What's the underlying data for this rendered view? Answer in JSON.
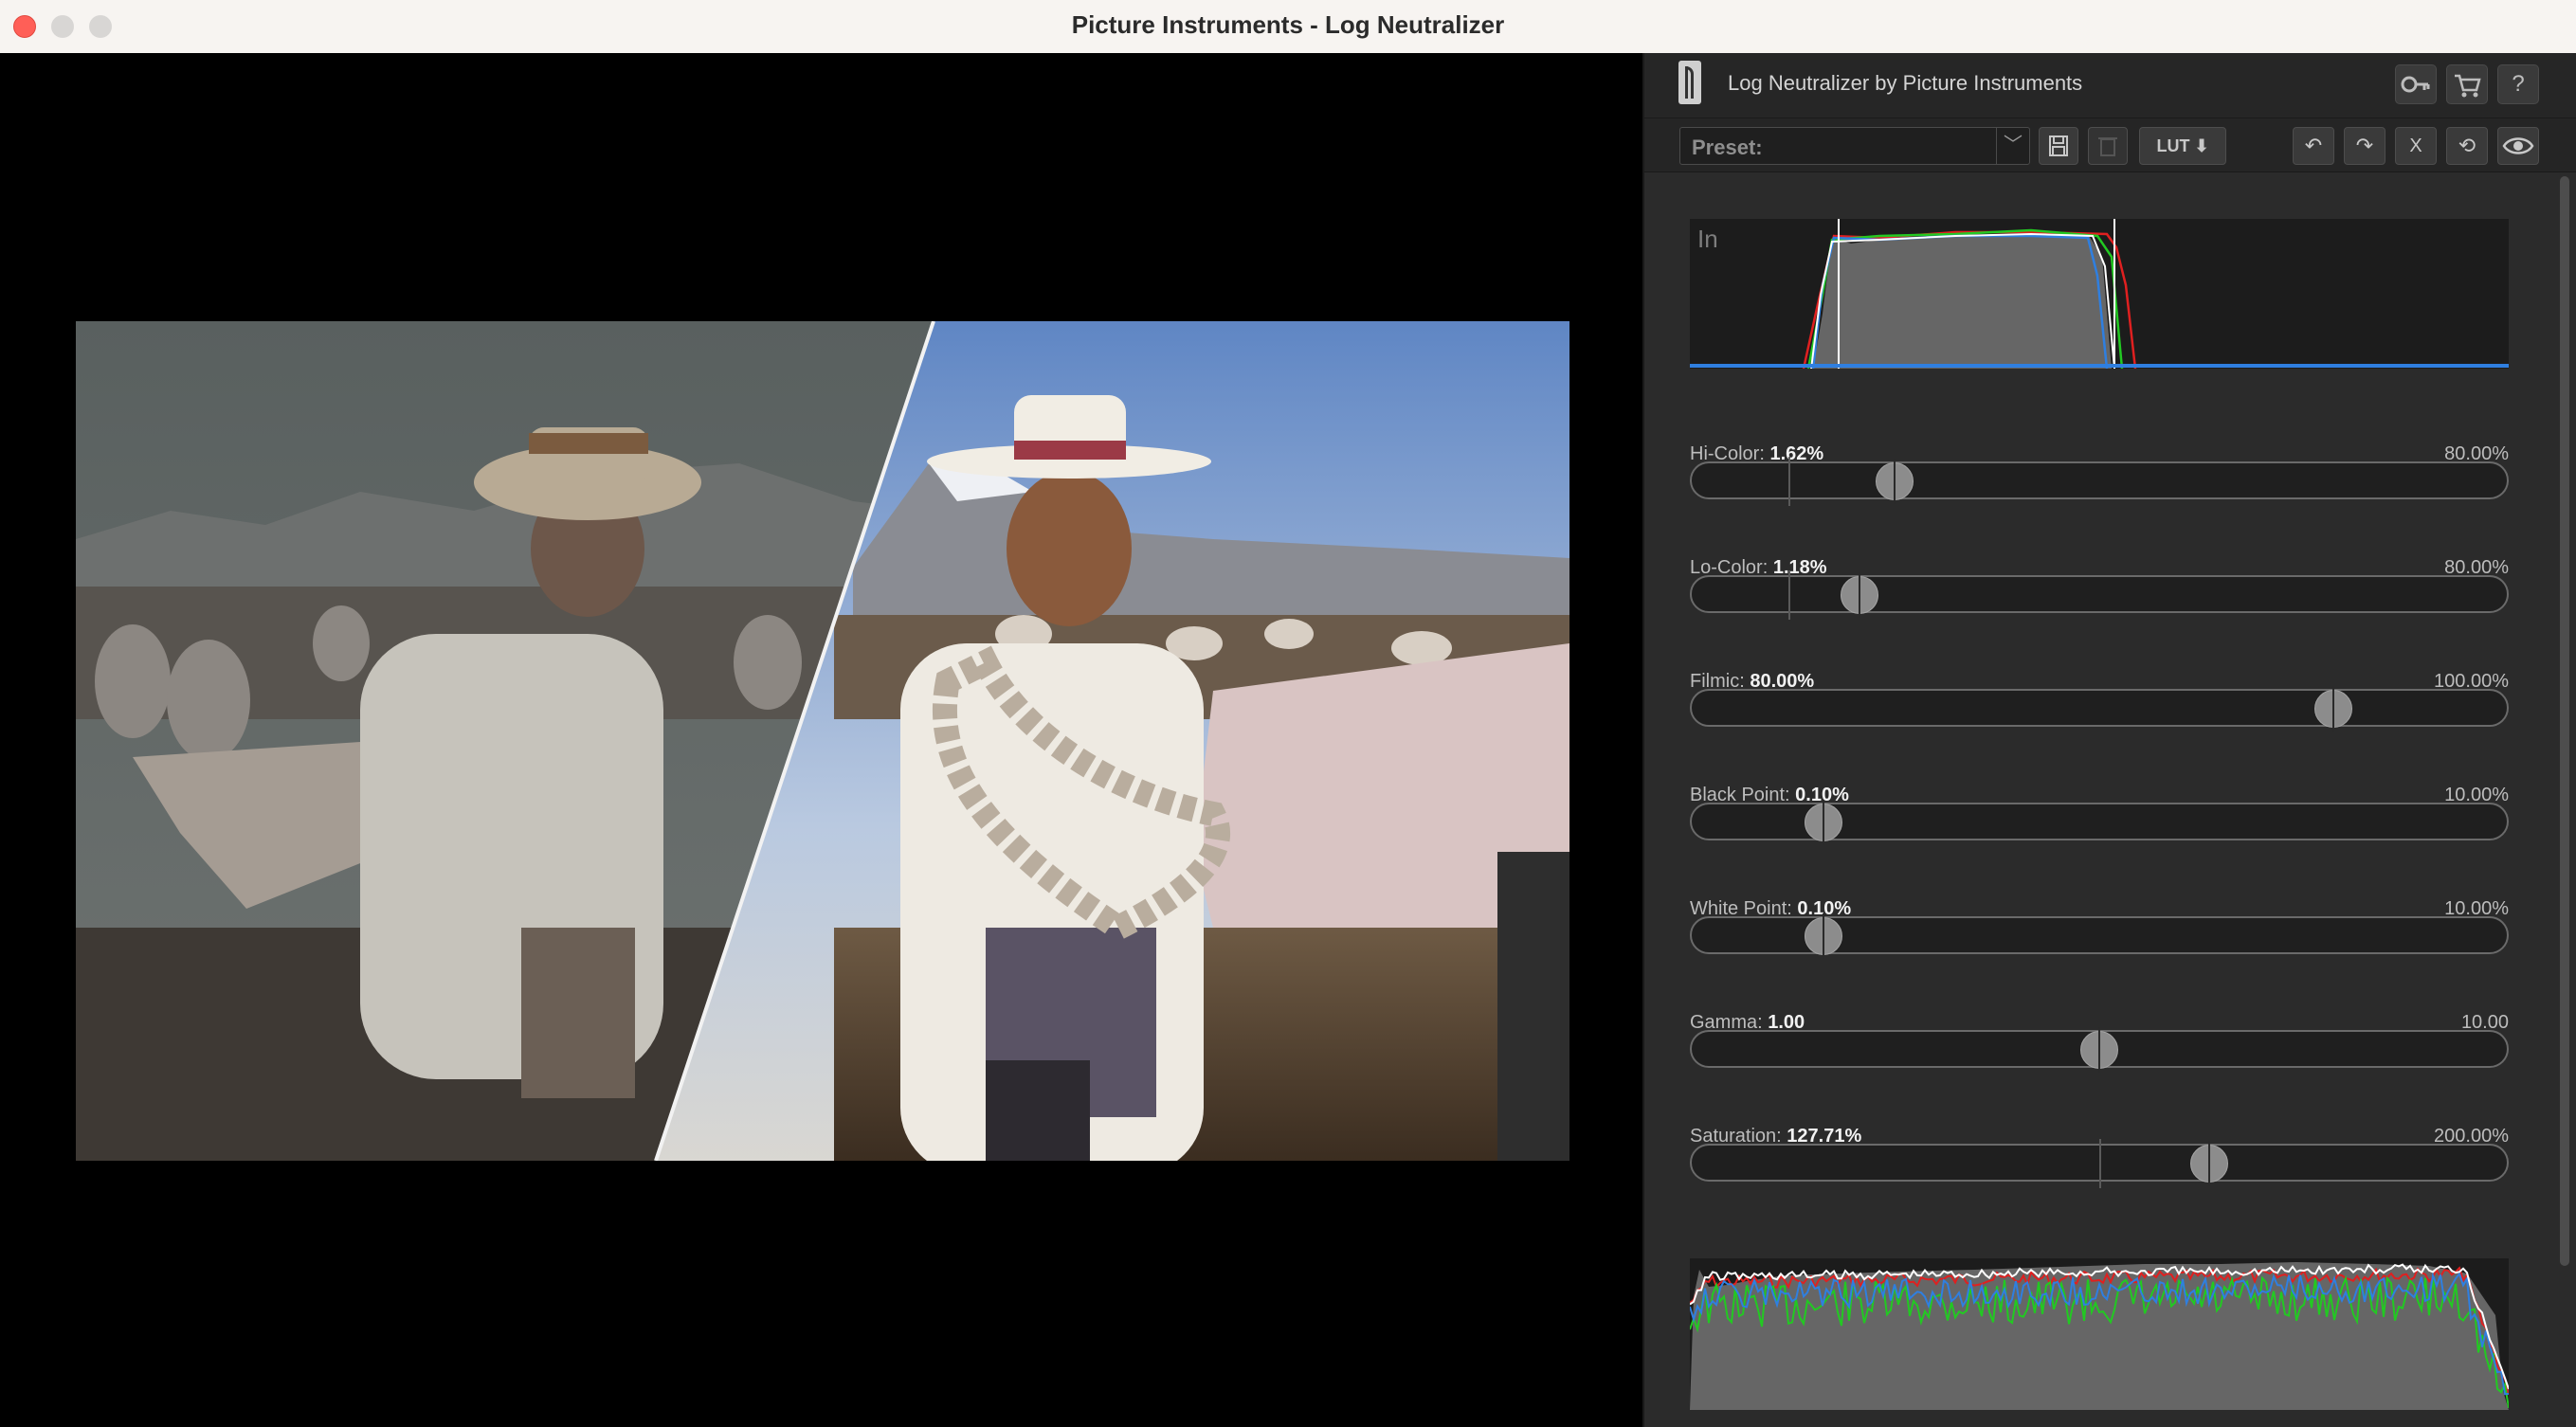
{
  "window": {
    "title": "Picture Instruments - Log Neutralizer"
  },
  "panel": {
    "title": "Log Neutralizer by Picture Instruments",
    "header_icons": [
      "key-icon",
      "cart-icon",
      "help-icon"
    ],
    "help_label": "?",
    "preset": {
      "label": "Preset:",
      "arrow": "﹀"
    },
    "toolbar": {
      "lut_label": "LUT ⬇",
      "undo_glyph": "↶",
      "redo_glyph": "↷",
      "clear_label": "X",
      "reset_glyph": "⟲",
      "eye_glyph": "◉"
    },
    "histogram_in_label": "In"
  },
  "sliders": [
    {
      "id": "hi-color",
      "name": "Hi-Color:",
      "value": "1.62%",
      "max": "80.00%",
      "fraction": 0.25,
      "tick": 0.12
    },
    {
      "id": "lo-color",
      "name": "Lo-Color:",
      "value": "1.18%",
      "max": "80.00%",
      "fraction": 0.207,
      "tick": 0.12
    },
    {
      "id": "filmic",
      "name": "Filmic:",
      "value": "80.00%",
      "max": "100.00%",
      "fraction": 0.786,
      "tick": null
    },
    {
      "id": "black-point",
      "name": "Black Point:",
      "value": "0.10%",
      "max": "10.00%",
      "fraction": 0.163,
      "tick": null
    },
    {
      "id": "white-point",
      "name": "White Point:",
      "value": "0.10%",
      "max": "10.00%",
      "fraction": 0.163,
      "tick": null
    },
    {
      "id": "gamma",
      "name": "Gamma:",
      "value": "1.00",
      "max": "10.00",
      "fraction": 0.5,
      "tick": null
    },
    {
      "id": "saturation",
      "name": "Saturation:",
      "value": "127.71%",
      "max": "200.00%",
      "fraction": 0.634,
      "tick": 0.5
    }
  ],
  "colors": {
    "panel_bg": "#2b2b2b",
    "hist_red": "#e02020",
    "hist_green": "#22c922",
    "hist_blue": "#2f7fe0",
    "hist_white": "#ffffff"
  }
}
